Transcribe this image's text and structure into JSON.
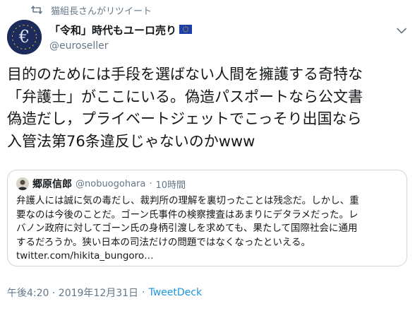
{
  "retweet": {
    "text": "猫組長さんがリツイート",
    "icon": "retweet-icon"
  },
  "author": {
    "display_name": "「令和」時代もユーロ売り",
    "flag_icon": "eu-flag-icon",
    "handle": "@euroseller",
    "avatar_icon": "euro-avatar-icon"
  },
  "tweet": {
    "text": "目的のためには手段を選ばない人間を擁護する奇特な\n「弁護士」がここにいる。偽造パスポートなら公文書\n偽造だし，プライベートジェットでこっそり出国なら\n入管法第76条違反じゃないのかwww"
  },
  "quote": {
    "name": "郷原信郎",
    "handle": "@nobuogohara",
    "dot": "·",
    "time": "10時間",
    "text": "弁護人には誠に気の毒だし、裁判所の理解を裏切ったことは残念だ。しかし、重\n要なのは今後のことだ。ゴーン氏事件の検察捜査はあまりにデタラメだった。レ\nバノン政府に対してゴーン氏の身柄引渡しを求めても、果たして国際社会に通用\nするだろうか。狭い日本の司法だけの問題ではなくなったといえる。\ntwitter.com/hikita_bungoro…"
  },
  "footer": {
    "timestamp": "午後4:20 · 2019年12月31日",
    "dot": "·",
    "source": "TweetDeck"
  },
  "colors": {
    "secondary_text": "#657786",
    "link": "#1b95e0",
    "border": "#ccd6dd"
  }
}
